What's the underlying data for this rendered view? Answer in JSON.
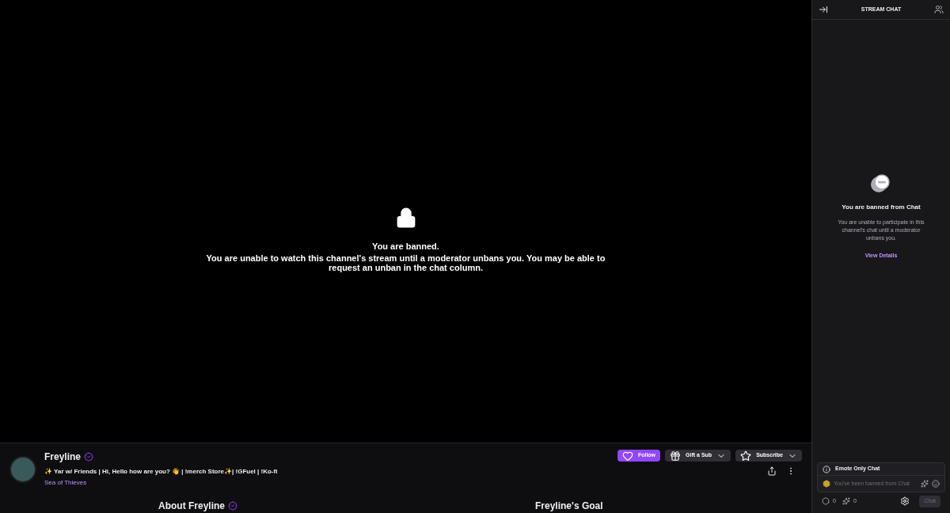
{
  "player": {
    "title": "You are banned.",
    "message": "You are unable to watch this channel's stream until a moderator unbans you. You may be able to request an unban in the chat column."
  },
  "channel": {
    "name": "Freyline",
    "verified": true,
    "stream_title": "✨ Yar w/ Friends | Hi, Hello how are you? 👋 | !merch Store✨| !GFuel | !Ko-fi",
    "category": "Sea of Thieves"
  },
  "buttons": [
    {
      "kind": "follow",
      "label": "Follow"
    },
    {
      "kind": "gift",
      "label": "Gift a Sub"
    },
    {
      "kind": "subscribe",
      "label": "Subscribe"
    }
  ],
  "sections": [
    {
      "title": "About Freyline",
      "verified": true
    },
    {
      "title": "Freyline's Goal",
      "verified": false
    }
  ],
  "chat": {
    "header": "STREAM CHAT",
    "banned_title": "You are banned from Chat",
    "banned_message": "You are unable to participate in this channel's chat until a moderator unbans you.",
    "details_link": "View Details",
    "mode_notice": "Emote Only Chat",
    "placeholder": "You've been banned from Chat",
    "points": "0",
    "bits": "0",
    "send_label": "Chat"
  }
}
